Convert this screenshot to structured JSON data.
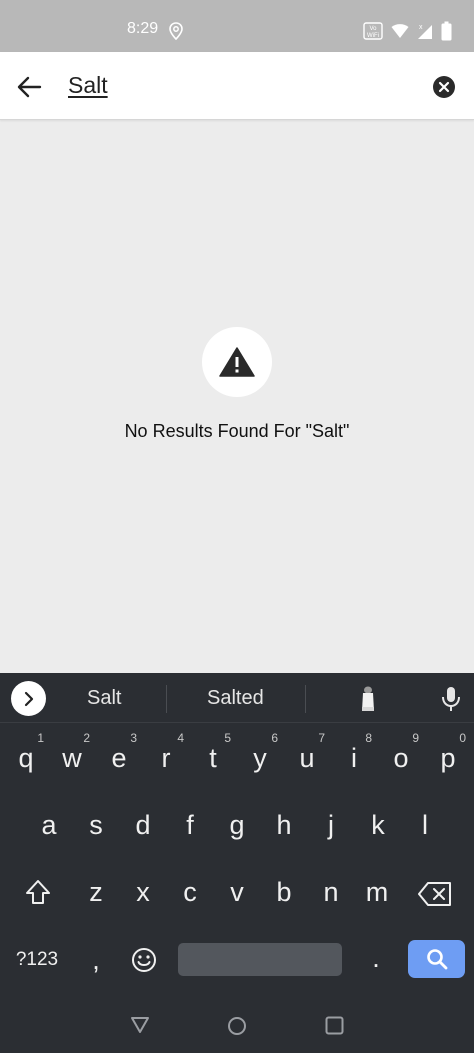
{
  "status_bar": {
    "time": "8:29",
    "location_icon": "location-pin-icon",
    "icons": [
      "volte-wifi-icon",
      "wifi-icon",
      "signal-icon",
      "battery-icon"
    ]
  },
  "search": {
    "query": "Salt",
    "back_icon": "back-arrow-icon",
    "clear_icon": "clear-icon"
  },
  "empty_state": {
    "icon": "warning-icon",
    "message": "No Results Found For \"Salt\""
  },
  "keyboard": {
    "suggestions": [
      "Salt",
      "Salted"
    ],
    "row1": [
      {
        "label": "q",
        "hint": "1"
      },
      {
        "label": "w",
        "hint": "2"
      },
      {
        "label": "e",
        "hint": "3"
      },
      {
        "label": "r",
        "hint": "4"
      },
      {
        "label": "t",
        "hint": "5"
      },
      {
        "label": "y",
        "hint": "6"
      },
      {
        "label": "u",
        "hint": "7"
      },
      {
        "label": "i",
        "hint": "8"
      },
      {
        "label": "o",
        "hint": "9"
      },
      {
        "label": "p",
        "hint": "0"
      }
    ],
    "row2": [
      "a",
      "s",
      "d",
      "f",
      "g",
      "h",
      "j",
      "k",
      "l"
    ],
    "row3": [
      "z",
      "x",
      "c",
      "v",
      "b",
      "n",
      "m"
    ],
    "symbols_label": "?123",
    "comma_label": ",",
    "period_label": ".",
    "accent_color": "#6e9df3"
  },
  "colors": {
    "status_bar": "#b8b8b8",
    "background": "#ececec",
    "keyboard": "#2b2e33"
  }
}
